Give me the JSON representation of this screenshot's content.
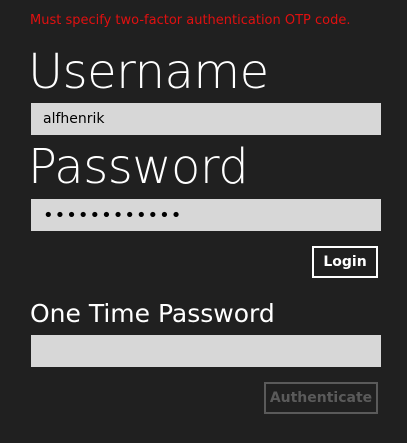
{
  "error_message": "Must specify two-factor authentication OTP code.",
  "username": {
    "label": "Username",
    "value": "alfhenrik"
  },
  "password": {
    "label": "Password",
    "masked_value": "••••••••••••"
  },
  "login_button": {
    "label": "Login"
  },
  "otp": {
    "label": "One Time Password",
    "value": ""
  },
  "authenticate_button": {
    "label": "Authenticate",
    "disabled": true
  },
  "colors": {
    "background": "#202020",
    "error": "#e01010",
    "field": "#d7d7d7",
    "disabled": "#5a5a5a"
  }
}
